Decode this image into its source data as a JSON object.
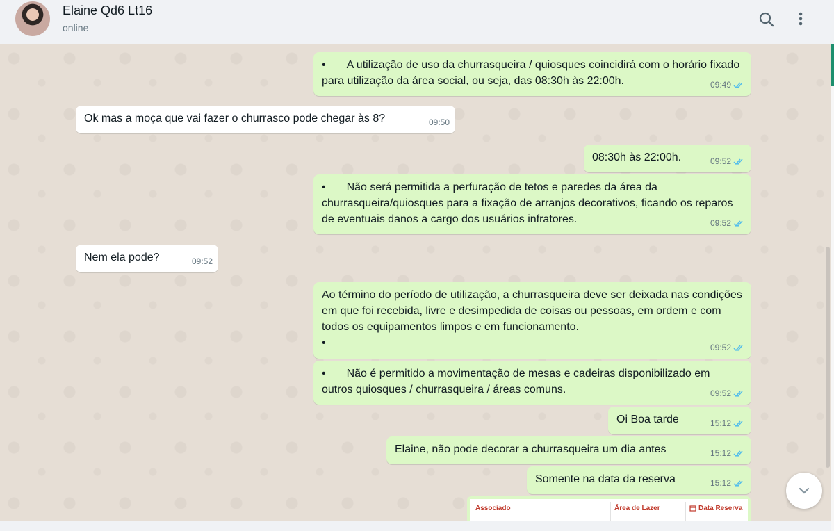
{
  "header": {
    "contact_name": "Elaine Qd6 Lt16",
    "status": "online",
    "search_icon": "search-icon",
    "menu_icon": "more-vertical-icon"
  },
  "colors": {
    "outgoing_bubble": "#dcf8c6",
    "incoming_bubble": "#ffffff",
    "read_ticks": "#53bdeb",
    "chat_background": "#e6ded5"
  },
  "messages": [
    {
      "direction": "out",
      "text": "•\tA utilização de uso da churrasqueira / quiosques coincidirá com o horário fixado para utilização da área social, ou seja, das 08:30h às 22:00h.",
      "time": "09:49",
      "status": "read"
    },
    {
      "direction": "in",
      "text": "Ok mas a moça que vai fazer o churrasco pode chegar às 8?",
      "time": "09:50"
    },
    {
      "direction": "out",
      "text": "08:30h às 22:00h.",
      "time": "09:52",
      "status": "read"
    },
    {
      "direction": "out",
      "text": "•\tNão será permitida a perfuração de tetos e paredes da área da churrasqueira/quiosques para a fixação de arranjos decorativos, ficando os reparos de eventuais danos a cargo dos usuários infratores.",
      "time": "09:52",
      "status": "read"
    },
    {
      "direction": "in",
      "text": "Nem ela pode?",
      "time": "09:52"
    },
    {
      "direction": "out",
      "text": "Ao término do período de utilização, a churrasqueira deve ser deixada nas condições em que foi recebida, livre e desimpedida de coisas ou pessoas, em ordem e com todos os equipamentos limpos e em funcionamento.\n•",
      "time": "09:52",
      "status": "read"
    },
    {
      "direction": "out",
      "text": "•\tNão é permitido a movimentação de mesas e cadeiras disponibilizado em outros quiosques / churrasqueira / áreas comuns.",
      "time": "09:52",
      "status": "read"
    },
    {
      "direction": "out",
      "text": "Oi Boa tarde",
      "time": "15:12",
      "status": "read"
    },
    {
      "direction": "out",
      "text": "Elaine, não pode decorar a churrasqueira um dia antes",
      "time": "15:12",
      "status": "read"
    },
    {
      "direction": "out",
      "text": "Somente na data da reserva",
      "time": "15:12",
      "status": "read"
    }
  ],
  "image_message": {
    "columns": [
      "Associado",
      "Área de Lazer",
      "Data Reserva"
    ],
    "column_icon": "calendar-icon"
  },
  "scroll_down_icon": "chevron-down-icon"
}
